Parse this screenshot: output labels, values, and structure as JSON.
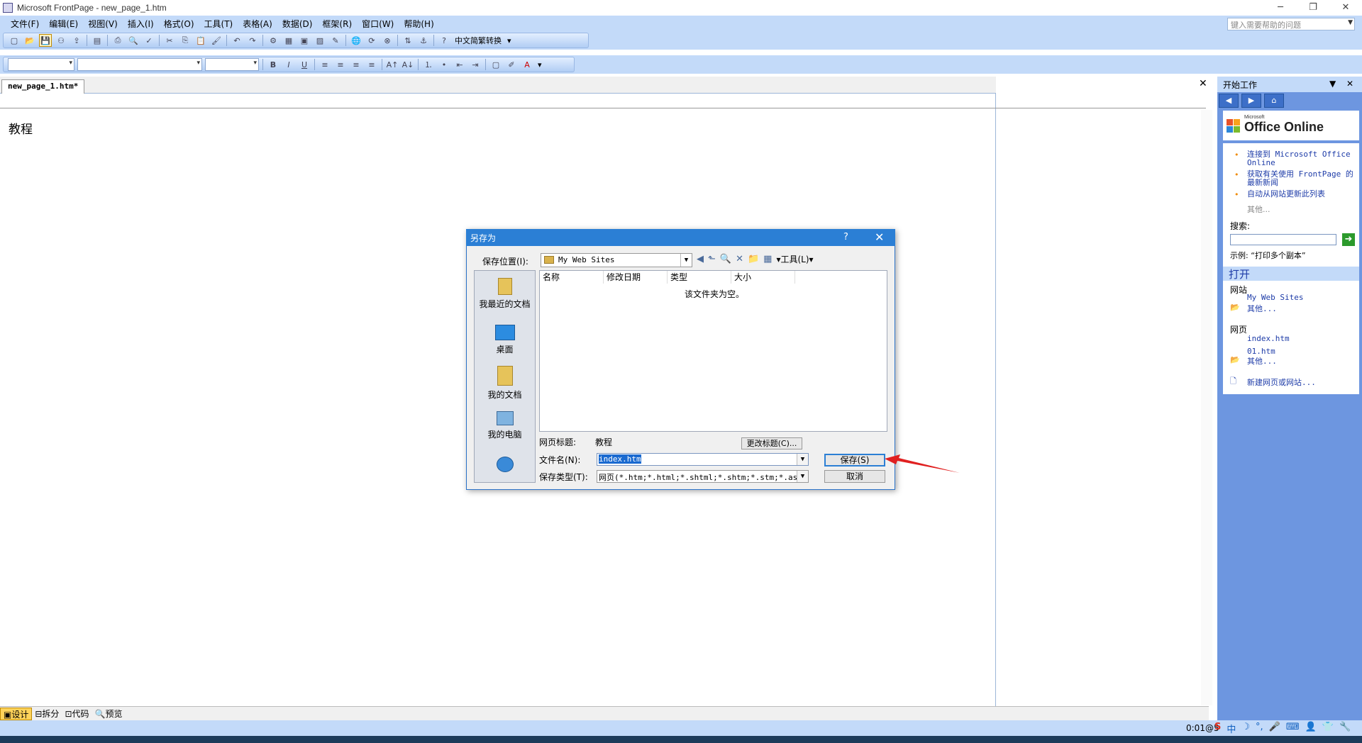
{
  "window": {
    "title": "Microsoft FrontPage - new_page_1.htm",
    "help_placeholder": "键入需要帮助的问题"
  },
  "menu": [
    "文件(F)",
    "编辑(E)",
    "视图(V)",
    "插入(I)",
    "格式(O)",
    "工具(T)",
    "表格(A)",
    "数据(D)",
    "框架(R)",
    "窗口(W)",
    "帮助(H)"
  ],
  "toolbar": {
    "convert_label": "中文简繁转换"
  },
  "document": {
    "tab_label": "new_page_1.htm*",
    "body_text": "教程"
  },
  "viewtabs": [
    "设计",
    "拆分",
    "代码",
    "预览"
  ],
  "status": {
    "time": "0:01@5"
  },
  "taskpane": {
    "header": "开始工作",
    "brand_small": "Microsoft",
    "brand": "Office Online",
    "links": [
      "连接到 Microsoft Office Online",
      "获取有关使用 FrontPage 的最新新闻",
      "自动从网站更新此列表"
    ],
    "more": "其他...",
    "search_label": "搜索:",
    "example": "示例: “打印多个副本”",
    "open_header": "打开",
    "sites_label": "网站",
    "site_item": "My Web Sites",
    "pages_label": "网页",
    "page_items": [
      "index.htm",
      "01.htm"
    ],
    "new_link": "新建网页或网站..."
  },
  "dialog": {
    "title": "另存为",
    "location_label": "保存位置(I):",
    "location_value": "My Web Sites",
    "tools_label": "工具(L)",
    "places": [
      "我最近的文档",
      "桌面",
      "我的文档",
      "我的电脑"
    ],
    "columns": [
      "名称",
      "修改日期",
      "类型",
      "大小"
    ],
    "empty_text": "该文件夹为空。",
    "page_title_label": "网页标题:",
    "page_title_value": "教程",
    "rename_button": "更改标题(C)...",
    "filename_label": "文件名(N):",
    "filename_value": "index.htm",
    "filetype_label": "保存类型(T):",
    "filetype_value": "网页(*.htm;*.html;*.shtml;*.shtm;*.stm;*.asp;*",
    "save_button": "保存(S)",
    "cancel_button": "取消"
  }
}
